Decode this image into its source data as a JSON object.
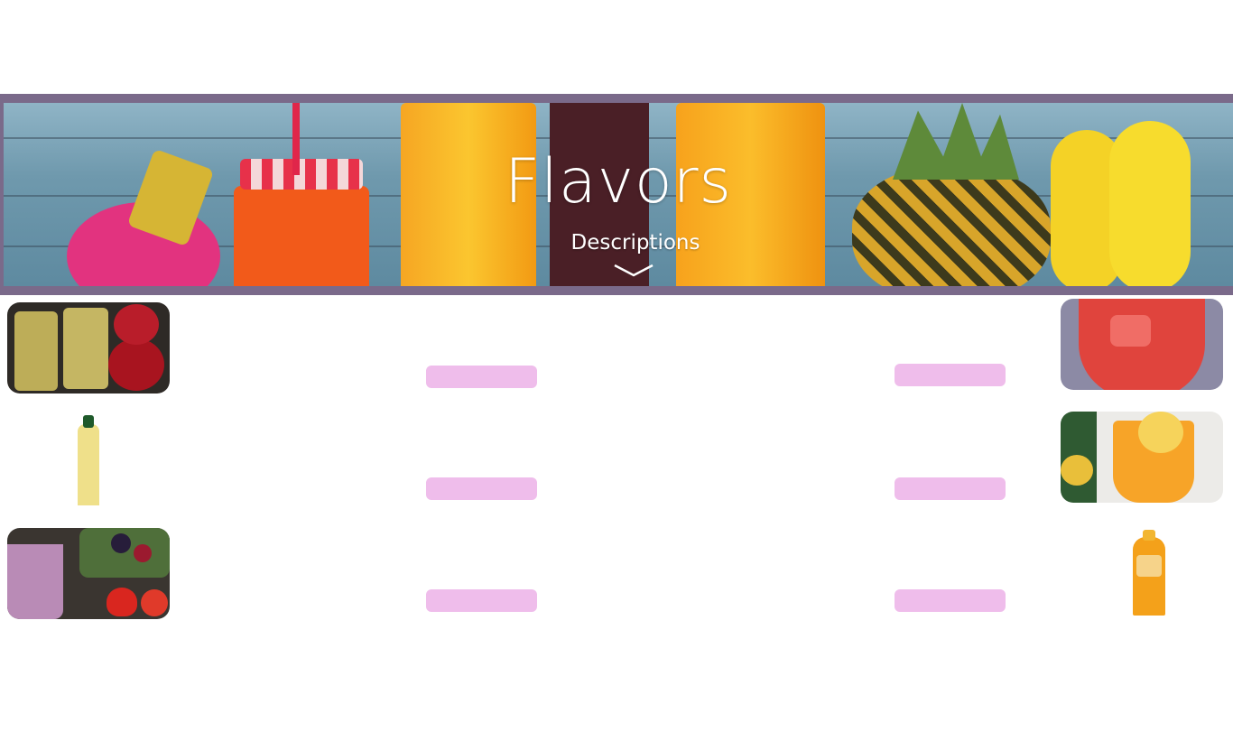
{
  "hero": {
    "title": "Flavors",
    "subtitle": "Descriptions",
    "frame_color": "#7a6a8a",
    "scroll_icon": "chevron-down-icon"
  },
  "products": {
    "left": [
      {
        "name": "apple-juice-jars-image",
        "image_style": "rounded-photo"
      },
      {
        "name": "juice-bottle-image",
        "image_style": "cutout"
      },
      {
        "name": "berry-smoothie-image",
        "image_style": "rounded-photo"
      }
    ],
    "right": [
      {
        "name": "red-fruit-drink-image",
        "image_style": "rounded-photo"
      },
      {
        "name": "lemon-orange-drink-image",
        "image_style": "rounded-photo"
      },
      {
        "name": "orange-juice-bottle-image",
        "image_style": "cutout"
      }
    ]
  },
  "buttons": {
    "color": "#efbdeb",
    "count": 6
  }
}
